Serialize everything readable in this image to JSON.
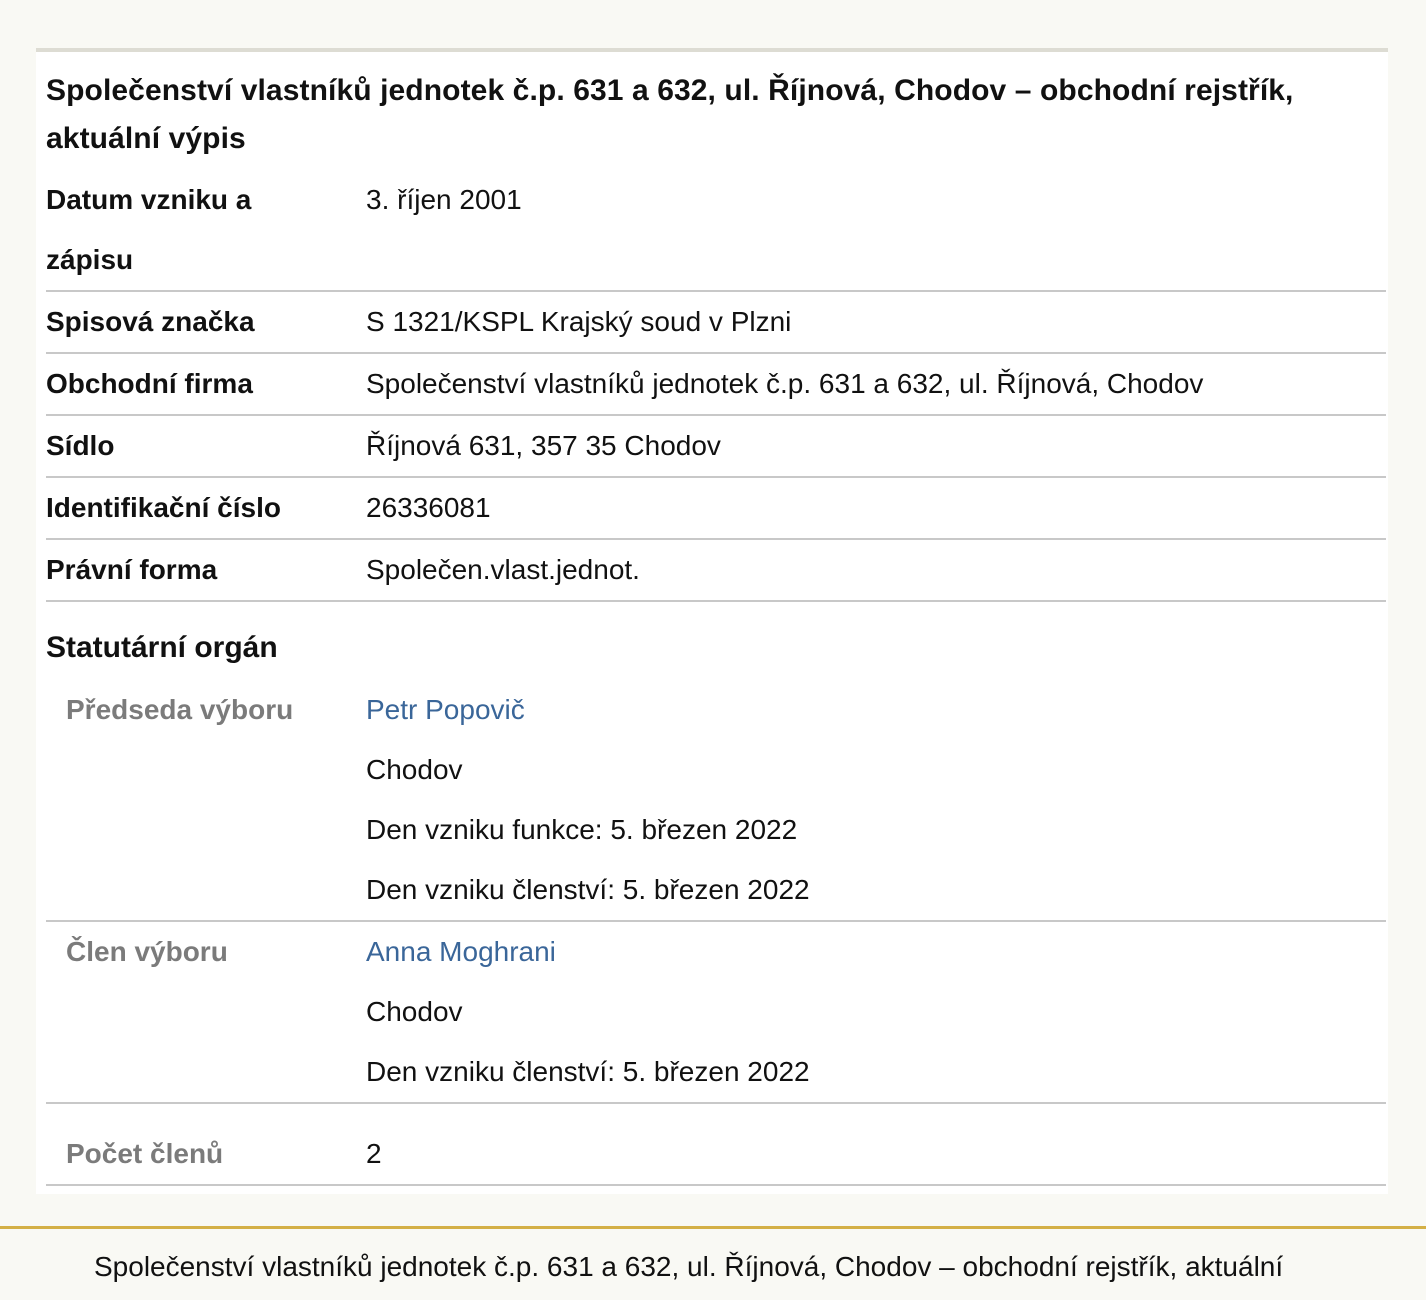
{
  "record": {
    "title": "Společenství vlastníků jednotek č.p. 631 a 632, ul. Říjnová, Chodov – obchodní rejstřík, aktuální výpis",
    "fields": [
      {
        "label": "Datum vzniku a zápisu",
        "value": "3. říjen 2001"
      },
      {
        "label": "Spisová značka",
        "value": "S 1321/KSPL Krajský soud v Plzni"
      },
      {
        "label": "Obchodní firma",
        "value": "Společenství vlastníků jednotek č.p. 631 a 632, ul. Říjnová, Chodov"
      },
      {
        "label": "Sídlo",
        "value": "Říjnová 631, 357 35 Chodov"
      },
      {
        "label": "Identifikační číslo",
        "value": "26336081"
      },
      {
        "label": "Právní forma",
        "value": "Společen.vlast.jednot."
      }
    ]
  },
  "statutory": {
    "heading": "Statutární orgán",
    "members": [
      {
        "role": "Předseda výboru",
        "name": "Petr Popovič",
        "city": "Chodov",
        "function_start": "Den vzniku funkce: 5. březen 2022",
        "membership_start": "Den vzniku členství: 5. březen 2022"
      },
      {
        "role": "Člen výboru",
        "name": "Anna Moghrani",
        "city": "Chodov",
        "membership_start": "Den vzniku členství: 5. březen 2022"
      }
    ],
    "count_label": "Počet členů",
    "count_value": "2"
  },
  "footer": {
    "text": "Společenství vlastníků jednotek č.p. 631 a 632, ul. Říjnová, Chodov – obchodní rejstřík, aktuální"
  },
  "colors": {
    "link": "#3a6699",
    "muted_label": "#7b7b7b",
    "footer_rule": "#d4b046",
    "background": "#f9f9f4"
  }
}
